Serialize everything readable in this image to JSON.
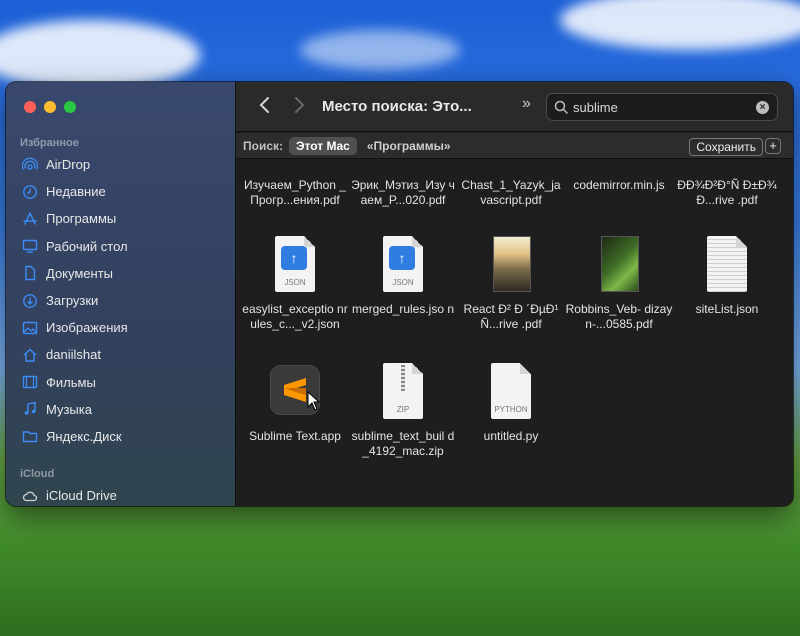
{
  "sidebar": {
    "favorites_title": "Избранное",
    "favorites": [
      {
        "label": "AirDrop",
        "icon": "airdrop-icon"
      },
      {
        "label": "Недавние",
        "icon": "clock-icon"
      },
      {
        "label": "Программы",
        "icon": "apps-icon"
      },
      {
        "label": "Рабочий стол",
        "icon": "desktop-icon"
      },
      {
        "label": "Документы",
        "icon": "document-icon"
      },
      {
        "label": "Загрузки",
        "icon": "download-icon"
      },
      {
        "label": "Изображения",
        "icon": "photo-icon"
      },
      {
        "label": "daniilshat",
        "icon": "home-icon"
      },
      {
        "label": "Фильмы",
        "icon": "film-icon"
      },
      {
        "label": "Музыка",
        "icon": "music-icon"
      },
      {
        "label": "Яндекс.Диск",
        "icon": "folder-icon"
      }
    ],
    "icloud_title": "iCloud",
    "icloud": [
      {
        "label": "iCloud Drive",
        "icon": "cloud-icon"
      }
    ]
  },
  "toolbar": {
    "title": "Место поиска: Это...",
    "more": "»",
    "search_value": "sublime"
  },
  "scope": {
    "label": "Поиск:",
    "active": "Этот Mac",
    "other": "«Программы»",
    "save": "Сохранить",
    "add": "+"
  },
  "files": [
    {
      "name": "Изучаем_Python _Прогр...ения.pdf",
      "kind": "pdf-partial"
    },
    {
      "name": "Эрик_Мэтиз_Изу чаем_P...020.pdf",
      "kind": "pdf-partial"
    },
    {
      "name": "Chast_1_Yazyk_ja vascript.pdf",
      "kind": "pdf-partial"
    },
    {
      "name": "codemirror.min.js",
      "kind": "js-partial"
    },
    {
      "name": "ÐÐ¾Ð²Ð°Ñ Ð±Ð¾Ð...rive .pdf",
      "kind": "pdf-partial"
    },
    {
      "name": "easylist_exceptio nrules_c..._v2.json",
      "kind": "json",
      "tag": "JSON"
    },
    {
      "name": "merged_rules.jso n",
      "kind": "json",
      "tag": "JSON"
    },
    {
      "name": "React Ð² Ð ´ÐµÐ¹Ñ...rive .pdf",
      "kind": "pdf"
    },
    {
      "name": "Robbins_Veb- dizayn-...0585.pdf",
      "kind": "pdf"
    },
    {
      "name": "siteList.json",
      "kind": "doc"
    },
    {
      "name": "Sublime Text.app",
      "kind": "app"
    },
    {
      "name": "sublime_text_buil d_4192_mac.zip",
      "kind": "zip",
      "tag": "ZIP"
    },
    {
      "name": "untitled.py",
      "kind": "py",
      "tag": "PYTHON"
    }
  ]
}
